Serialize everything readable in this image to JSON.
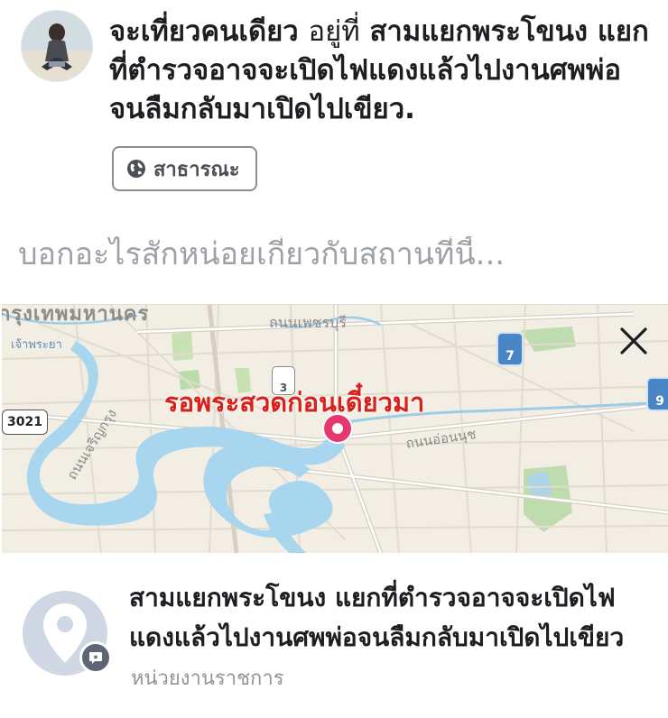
{
  "post": {
    "user_name": "จะเที่ยวคนเดียว",
    "checkin_prefix": "อยู่ที่",
    "location": "สามแยกพระโขนง แยกที่ตำรวจอาจจะเปิดไฟแดงแล้วไปงานศพพ่อจนลืมกลับมาเปิดไปเขียว."
  },
  "audience": {
    "label": "สาธารณะ",
    "icon": "globe-icon"
  },
  "composer": {
    "placeholder": "บอกอะไรสักหน่อยเกี่ยวกับสถานที่นี้..."
  },
  "map": {
    "pin_label": "รอพระสวดก่อนเดี๋ยวมา",
    "street_labels": [
      "ถนนเพชรบุรี",
      "ถนนอ่อนนุช",
      "ถนนเจริญกรุง",
      "เจ้าพระยา",
      "กรุงเทพมหานคร"
    ],
    "route_badges": [
      "3021",
      "7",
      "9",
      "3"
    ],
    "close_icon": "close-icon",
    "pin_color": "#e5386e"
  },
  "place": {
    "name": "สามแยกพระโขนง แยกที่ตำรวจอาจจะเปิดไฟแดงแล้วไปงานศพพ่อจนลืมกลับมาเปิดไปเขียว",
    "category": "หน่วยงานราชการ",
    "icon": "location-pin-icon",
    "badge_icon": "comment-icon"
  }
}
